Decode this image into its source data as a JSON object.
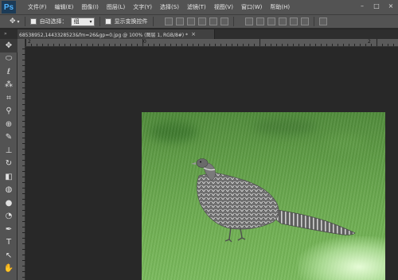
{
  "app": {
    "logo": "Ps"
  },
  "menu": {
    "items": [
      "文件(F)",
      "编辑(E)",
      "图像(I)",
      "图层(L)",
      "文字(Y)",
      "选择(S)",
      "滤镜(T)",
      "视图(V)",
      "窗口(W)",
      "帮助(H)"
    ]
  },
  "window_controls": {
    "minimize": "–",
    "maximize": "□",
    "close": "×"
  },
  "options": {
    "auto_select_label": "自动选择：",
    "auto_select_value": "组",
    "show_transform_label": "显示变换控件"
  },
  "document": {
    "tab_title": "68538952,1443328523&fm=26&gp=0.jpg @ 100% (图层 1, RGB/8#) *",
    "tab_close": "×"
  },
  "ruler": {
    "labels": [
      "2",
      "0",
      "2"
    ]
  },
  "tools": [
    {
      "name": "move-tool",
      "glyph": "✥"
    },
    {
      "name": "marquee-tool",
      "glyph": "⬭"
    },
    {
      "name": "lasso-tool",
      "glyph": "ℓ"
    },
    {
      "name": "quick-select-tool",
      "glyph": "⁂"
    },
    {
      "name": "crop-tool",
      "glyph": "⌗"
    },
    {
      "name": "eyedropper-tool",
      "glyph": "⚲"
    },
    {
      "name": "healing-tool",
      "glyph": "⊕"
    },
    {
      "name": "brush-tool",
      "glyph": "✎"
    },
    {
      "name": "stamp-tool",
      "glyph": "⊥"
    },
    {
      "name": "history-brush-tool",
      "glyph": "↻"
    },
    {
      "name": "eraser-tool",
      "glyph": "◧"
    },
    {
      "name": "gradient-tool",
      "glyph": "◍"
    },
    {
      "name": "blur-tool",
      "glyph": "●"
    },
    {
      "name": "dodge-tool",
      "glyph": "◔"
    },
    {
      "name": "pen-tool",
      "glyph": "✒"
    },
    {
      "name": "type-tool",
      "glyph": "T"
    },
    {
      "name": "path-select-tool",
      "glyph": "↖"
    },
    {
      "name": "hand-tool",
      "glyph": "✋"
    }
  ],
  "colors": {
    "panel": "#535353",
    "canvas_bg": "#282828"
  }
}
